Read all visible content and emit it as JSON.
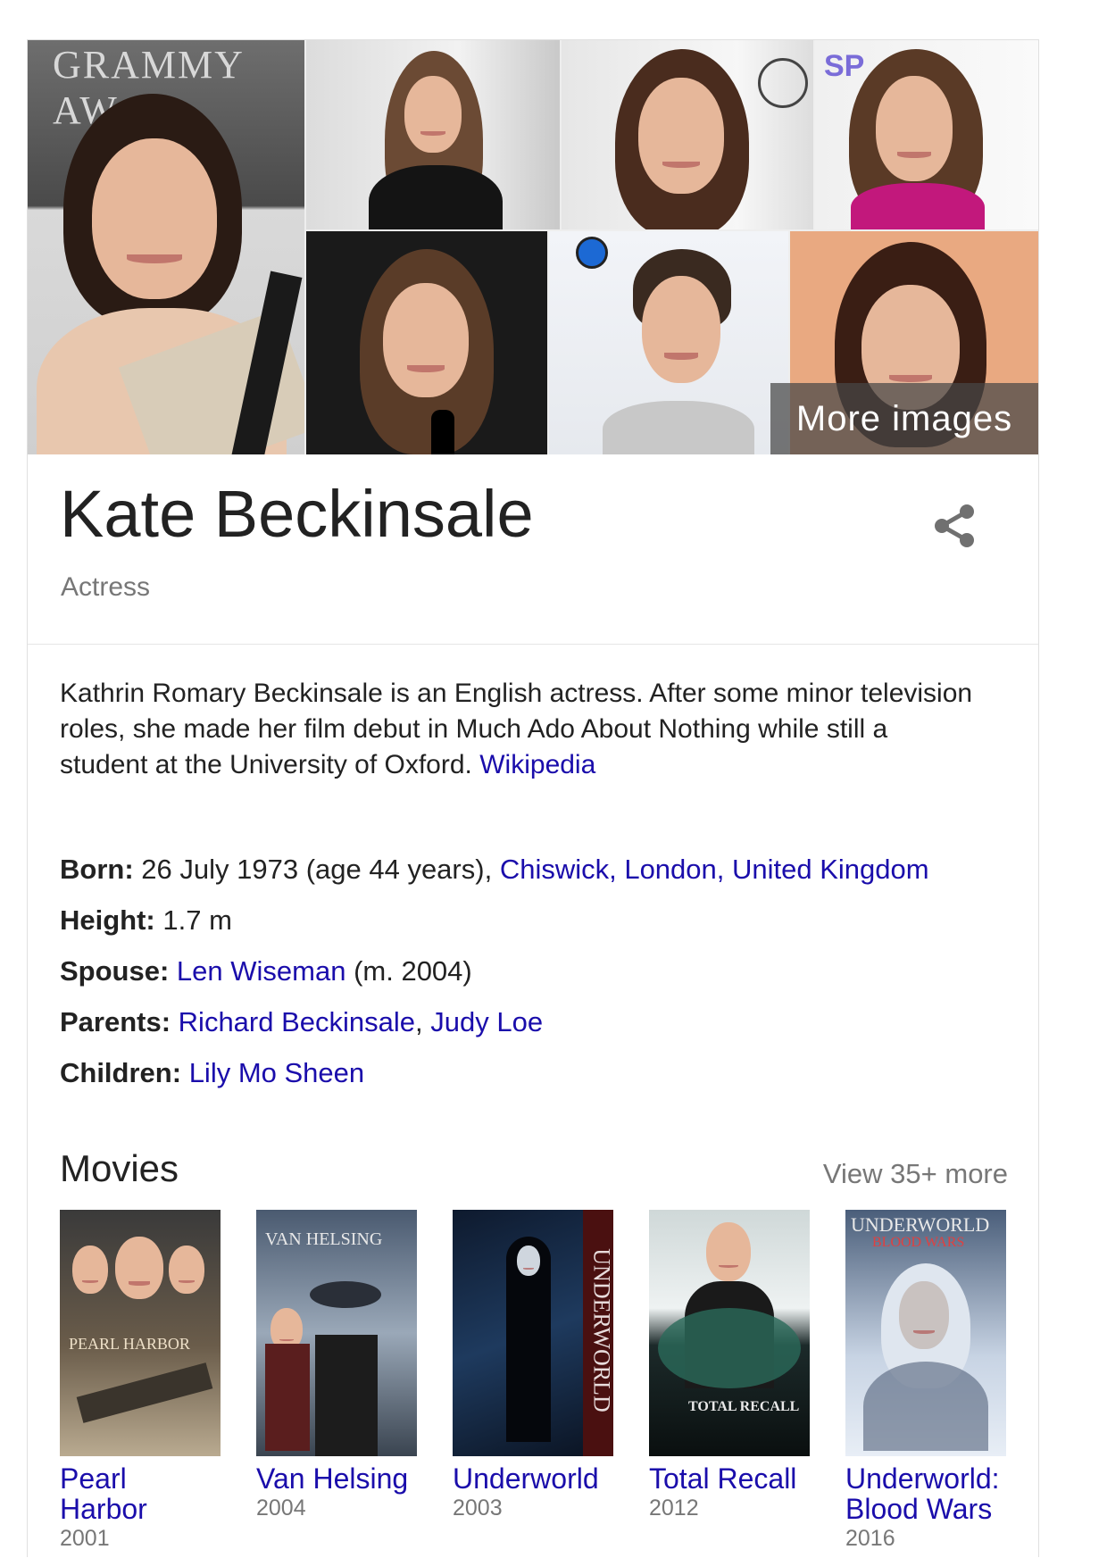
{
  "photos": {
    "grammy_text": "GRAMMY AW",
    "more_images": "More images"
  },
  "header": {
    "title": "Kate Beckinsale",
    "subtitle": "Actress",
    "share_icon": "share-icon"
  },
  "description": {
    "text": "Kathrin Romary Beckinsale is an English actress. After some minor television roles, she made her film debut in Much Ado About Nothing while still a student at the University of Oxford.",
    "source_link": "Wikipedia"
  },
  "facts": {
    "born": {
      "label": "Born:",
      "text": "26 July 1973 (age 44 years),",
      "link": "Chiswick, London, United Kingdom"
    },
    "height": {
      "label": "Height:",
      "text": "1.7 m"
    },
    "spouse": {
      "label": "Spouse:",
      "link": "Len Wiseman",
      "text": "(m. 2004)"
    },
    "parents": {
      "label": "Parents:",
      "link1": "Richard Beckinsale",
      "sep": ",",
      "link2": "Judy Loe"
    },
    "children": {
      "label": "Children:",
      "link": "Lily Mo Sheen"
    }
  },
  "movies": {
    "heading": "Movies",
    "view_more": "View 35+ more",
    "items": [
      {
        "title_line1": "Pearl",
        "title_line2": "Harbor",
        "year": "2001",
        "poster_text": "PEARL HARBOR"
      },
      {
        "title_line1": "Van Helsing",
        "title_line2": "",
        "year": "2004",
        "poster_text": "VAN HELSING"
      },
      {
        "title_line1": "Underworld",
        "title_line2": "",
        "year": "2003",
        "poster_text": "UNDERWORLD"
      },
      {
        "title_line1": "Total Recall",
        "title_line2": "",
        "year": "2012",
        "poster_text": "TOTAL RECALL"
      },
      {
        "title_line1": "Underworld:",
        "title_line2": "Blood Wars",
        "year": "2016",
        "poster_text": "UNDERWORLD",
        "poster_subtext": "BLOOD WARS"
      }
    ]
  }
}
